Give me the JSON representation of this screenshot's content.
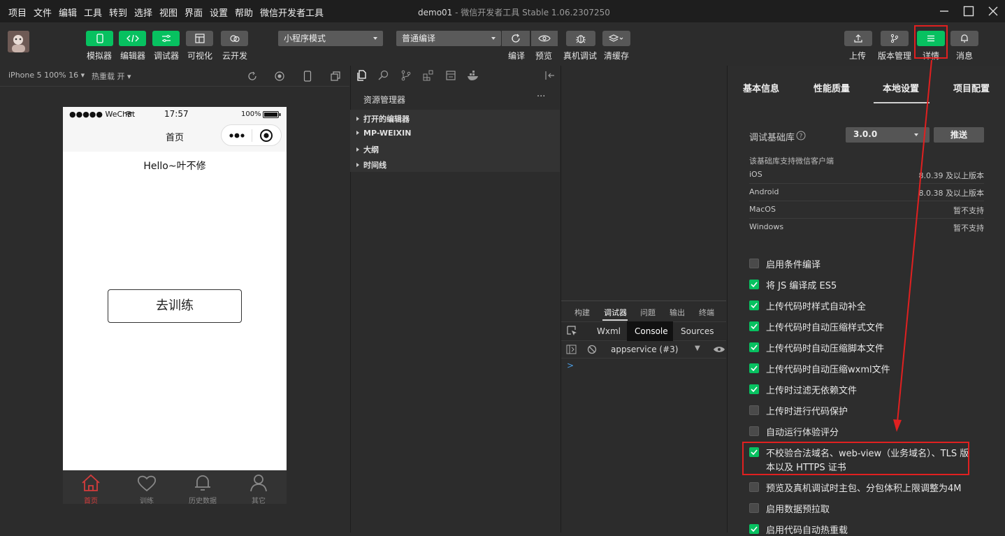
{
  "menu": [
    "项目",
    "文件",
    "编辑",
    "工具",
    "转到",
    "选择",
    "视图",
    "界面",
    "设置",
    "帮助",
    "微信开发者工具"
  ],
  "window": {
    "title_main": "demo01",
    "title_sep": " - ",
    "title_app": "微信开发者工具 Stable 1.06.2307250"
  },
  "toolbar": {
    "left_buttons": [
      {
        "label": "模拟器",
        "icon": "phone-icon"
      },
      {
        "label": "编辑器",
        "icon": "code-icon"
      },
      {
        "label": "调试器",
        "icon": "debug-icon"
      },
      {
        "label": "可视化",
        "icon": "layout-icon"
      },
      {
        "label": "云开发",
        "icon": "cloud-icon"
      }
    ],
    "mode_select": "小程序模式",
    "compile_select": "普通编译",
    "mid_buttons": [
      {
        "label": "编译",
        "icon": "refresh-icon"
      },
      {
        "label": "预览",
        "icon": "eye-icon"
      },
      {
        "label": "真机调试",
        "icon": "bug-icon"
      },
      {
        "label": "清缓存",
        "icon": "layers-icon"
      }
    ],
    "right_buttons": [
      {
        "label": "上传",
        "icon": "upload-icon"
      },
      {
        "label": "版本管理",
        "icon": "branch-icon"
      },
      {
        "label": "详情",
        "icon": "menu-icon"
      },
      {
        "label": "消息",
        "icon": "bell-icon"
      }
    ]
  },
  "simulator": {
    "device": "iPhone 5 100% 16",
    "hotreload": "热重载 开",
    "status_carrier": "●●●●● WeChat",
    "status_time": "17:57",
    "status_battery": "100%",
    "nav_title": "首页",
    "hello_text": "Hello~叶不修",
    "main_button": "去训练",
    "tabs": [
      {
        "label": "首页",
        "active": true,
        "icon": "home-icon"
      },
      {
        "label": "训练",
        "active": false,
        "icon": "heart-icon"
      },
      {
        "label": "历史数据",
        "active": false,
        "icon": "bell-icon"
      },
      {
        "label": "其它",
        "active": false,
        "icon": "person-icon"
      }
    ]
  },
  "explorer": {
    "title": "资源管理器",
    "more": "···",
    "items": [
      "打开的编辑器",
      "MP-WEIXIN",
      "大纲",
      "时间线"
    ]
  },
  "debugger": {
    "top_tabs": [
      "构建",
      "调试器",
      "问题",
      "输出",
      "终端"
    ],
    "active_top_tab": "调试器",
    "devtools_tabs": [
      "Wxml",
      "Console",
      "Sources"
    ],
    "active_devtools_tab": "Console",
    "context": "appservice (#3)",
    "prompt": ">"
  },
  "details": {
    "tabs": [
      "基本信息",
      "性能质量",
      "本地设置",
      "项目配置"
    ],
    "active_tab": "本地设置",
    "lib_label": "调试基础库",
    "lib_version": "3.0.0",
    "push_button": "推送",
    "support_title": "该基础库支持微信客户端",
    "support_rows": [
      {
        "platform": "iOS",
        "value": "8.0.39 及以上版本"
      },
      {
        "platform": "Android",
        "value": "8.0.38 及以上版本"
      },
      {
        "platform": "MacOS",
        "value": "暂不支持"
      },
      {
        "platform": "Windows",
        "value": "暂不支持"
      }
    ],
    "settings": [
      {
        "label": "启用条件编译",
        "checked": false
      },
      {
        "label": "将 JS 编译成 ES5",
        "checked": true
      },
      {
        "label": "上传代码时样式自动补全",
        "checked": true
      },
      {
        "label": "上传代码时自动压缩样式文件",
        "checked": true
      },
      {
        "label": "上传代码时自动压缩脚本文件",
        "checked": true
      },
      {
        "label": "上传代码时自动压缩wxml文件",
        "checked": true
      },
      {
        "label": "上传时过滤无依赖文件",
        "checked": true
      },
      {
        "label": "上传时进行代码保护",
        "checked": false
      },
      {
        "label": "自动运行体验评分",
        "checked": false
      },
      {
        "label": "不校验合法域名、web-view（业务域名）、TLS 版",
        "label2": "本以及 HTTPS 证书",
        "checked": true
      },
      {
        "label": "预览及真机调试时主包、分包体积上限调整为4M",
        "checked": false
      },
      {
        "label": "启用数据预拉取",
        "checked": false
      },
      {
        "label": "启用代码自动热重载",
        "checked": true
      }
    ]
  },
  "colors": {
    "accent": "#07c160",
    "highlight": "#e02020",
    "bg": "#2c2c2c",
    "tab_active": "#d43c3c"
  }
}
